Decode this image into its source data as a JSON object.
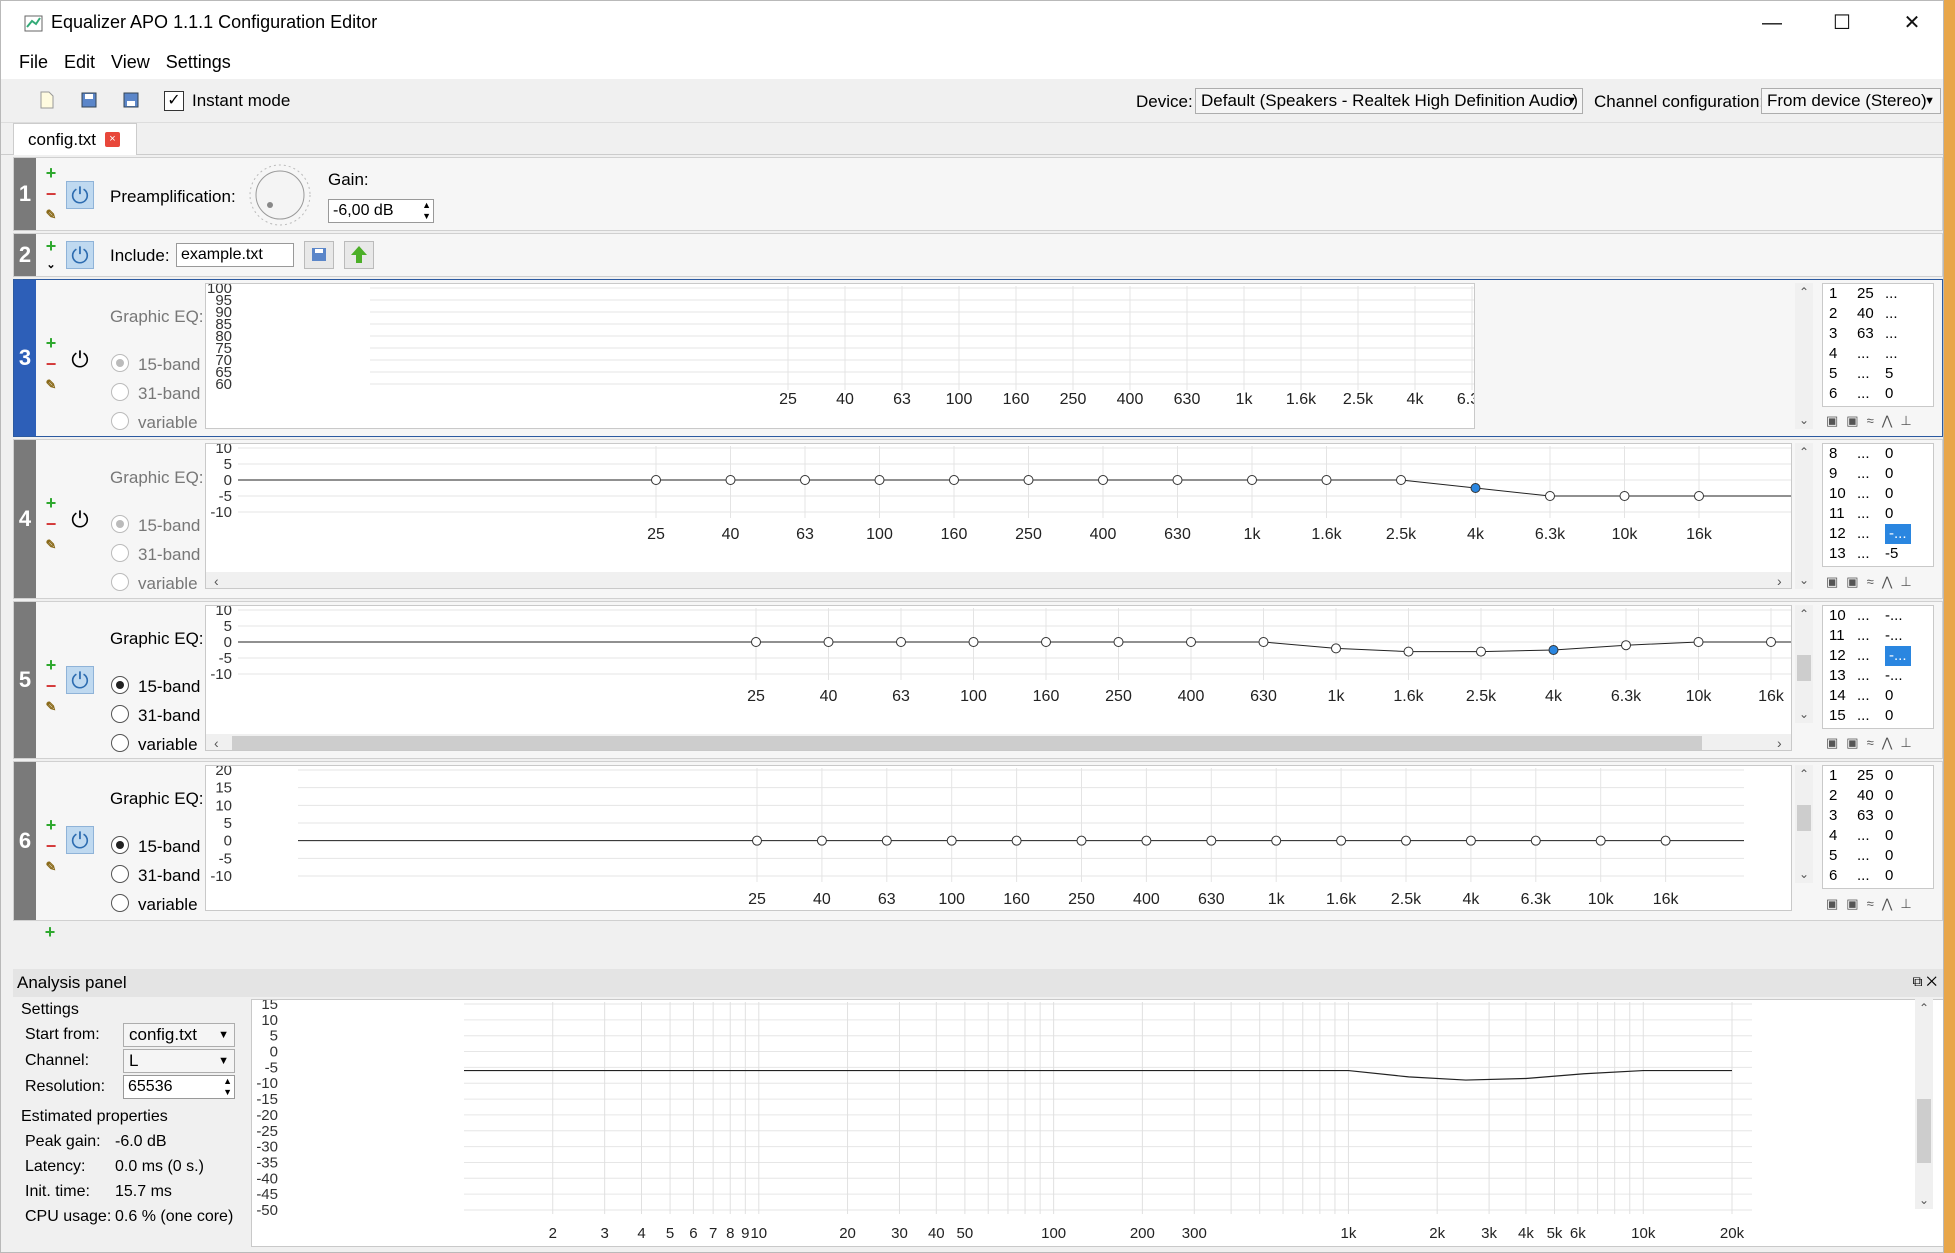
{
  "window": {
    "title": "Equalizer APO 1.1.1 Configuration Editor",
    "controls": [
      "—",
      "☐",
      "✕"
    ]
  },
  "menu": [
    "File",
    "Edit",
    "View",
    "Settings"
  ],
  "toolbar": {
    "instant_mode_label": "Instant mode",
    "instant_mode_checked": true,
    "device_label": "Device:",
    "device_value": "Default (Speakers - Realtek High Definition Audio)",
    "channel_label": "Channel configuration:",
    "channel_value": "From device (Stereo)"
  },
  "tab": {
    "label": "config.txt",
    "close": "×"
  },
  "row1": {
    "num": "1",
    "label": "Preamplification:",
    "gain_label": "Gain:",
    "gain_value": "-6,00 dB"
  },
  "row2": {
    "num": "2",
    "label": "Include:",
    "file": "example.txt"
  },
  "geq_common": {
    "title": "Graphic EQ:",
    "opt15": "15-band",
    "opt31": "31-band",
    "optvar": "variable"
  },
  "freq_labels": [
    "25",
    "40",
    "63",
    "100",
    "160",
    "250",
    "400",
    "630",
    "1k",
    "1.6k",
    "2.5k",
    "4k",
    "6.3k",
    "10k",
    "16k"
  ],
  "row3": {
    "num": "3",
    "ylabels": [
      "100",
      "95",
      "90",
      "85",
      "80",
      "75",
      "70",
      "65",
      "60"
    ],
    "table": [
      [
        "1",
        "25",
        "..."
      ],
      [
        "2",
        "40",
        "..."
      ],
      [
        "3",
        "63",
        "..."
      ],
      [
        "4",
        "...",
        "..."
      ],
      [
        "5",
        "...",
        "5"
      ],
      [
        "6",
        "...",
        "0"
      ]
    ]
  },
  "row4": {
    "num": "4",
    "ylabels": [
      "10",
      "5",
      "0",
      "-5",
      "-10"
    ],
    "gains": [
      0,
      0,
      0,
      0,
      0,
      0,
      0,
      0,
      0,
      0,
      0,
      -2.5,
      -5,
      -5,
      -5
    ],
    "table": [
      [
        "8",
        "...",
        "0"
      ],
      [
        "9",
        "...",
        "0"
      ],
      [
        "10",
        "...",
        "0"
      ],
      [
        "11",
        "...",
        "0"
      ],
      [
        "12",
        "...",
        "-..."
      ],
      [
        "13",
        "...",
        "-5"
      ]
    ]
  },
  "row5": {
    "num": "5",
    "ylabels": [
      "10",
      "5",
      "0",
      "-5",
      "-10"
    ],
    "gains": [
      0,
      0,
      0,
      0,
      0,
      0,
      0,
      0,
      -2,
      -3,
      -3,
      -2.5,
      -1,
      0,
      0
    ],
    "table": [
      [
        "10",
        "...",
        "-..."
      ],
      [
        "11",
        "...",
        "-..."
      ],
      [
        "12",
        "...",
        "-..."
      ],
      [
        "13",
        "...",
        "-..."
      ],
      [
        "14",
        "...",
        "0"
      ],
      [
        "15",
        "...",
        "0"
      ]
    ]
  },
  "row6": {
    "num": "6",
    "ylabels": [
      "20",
      "15",
      "10",
      "5",
      "0",
      "-5",
      "-10"
    ],
    "gains": [
      0,
      0,
      0,
      0,
      0,
      0,
      0,
      0,
      0,
      0,
      0,
      0,
      0,
      0,
      0
    ],
    "table": [
      [
        "1",
        "25",
        "0"
      ],
      [
        "2",
        "40",
        "0"
      ],
      [
        "3",
        "63",
        "0"
      ],
      [
        "4",
        "...",
        "0"
      ],
      [
        "5",
        "...",
        "0"
      ],
      [
        "6",
        "...",
        "0"
      ]
    ]
  },
  "analysis": {
    "title": "Analysis panel",
    "settings_title": "Settings",
    "start_from_label": "Start from:",
    "start_from_value": "config.txt",
    "channel_label": "Channel:",
    "channel_value": "L",
    "resolution_label": "Resolution:",
    "resolution_value": "65536",
    "est_title": "Estimated properties",
    "peak_label": "Peak gain:",
    "peak_value": "-6.0 dB",
    "latency_label": "Latency:",
    "latency_value": "0.0 ms (0 s.)",
    "init_label": "Init. time:",
    "init_value": "15.7 ms",
    "cpu_label": "CPU usage:",
    "cpu_value": "0.6 % (one core)",
    "ylabels": [
      "15",
      "10",
      "5",
      "0",
      "-5",
      "-10",
      "-15",
      "-20",
      "-25",
      "-30",
      "-35",
      "-40",
      "-45",
      "-50"
    ],
    "xlabels": [
      "2",
      "3",
      "4",
      "5",
      "6",
      "7",
      "8",
      "9",
      "10",
      "20",
      "30",
      "40",
      "50",
      "100",
      "200",
      "300",
      "1k",
      "2k",
      "3k",
      "4k",
      "5k",
      "6k",
      "10k",
      "20k"
    ]
  },
  "chart_data": {
    "type": "line",
    "title": "",
    "xlabel": "",
    "ylabel": "",
    "x_scale": "log",
    "ylim": [
      -50,
      15
    ],
    "x": [
      20,
      1000,
      1600,
      2500,
      4000,
      6300,
      10000,
      20000
    ],
    "series": [
      {
        "values": [
          -6,
          -6,
          -8,
          -9,
          -8.5,
          -7,
          -6,
          -6
        ]
      }
    ]
  }
}
